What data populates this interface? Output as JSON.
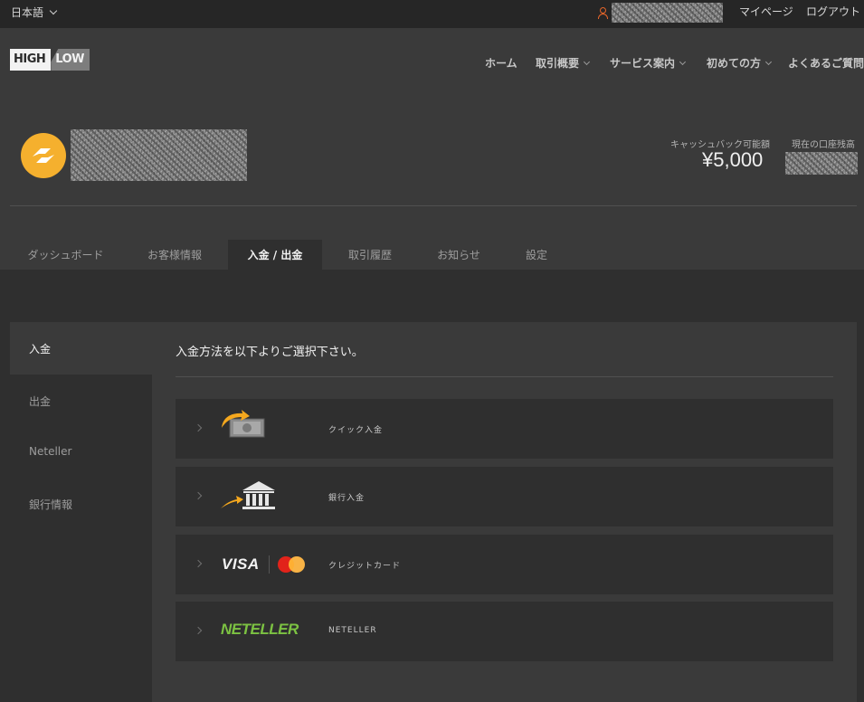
{
  "topbar": {
    "language": "日本語",
    "mypage": "マイページ",
    "logout": "ログアウト"
  },
  "header": {
    "logo_high": "HIGH",
    "logo_low": "LOW",
    "nav": [
      {
        "label": "ホーム",
        "dropdown": false
      },
      {
        "label": "取引概要",
        "dropdown": true
      },
      {
        "label": "サービス案内",
        "dropdown": true
      },
      {
        "label": "初めての方",
        "dropdown": true
      },
      {
        "label": "よくあるご質問",
        "dropdown": false
      }
    ]
  },
  "account": {
    "cashback_label": "キャッシュバック可能額",
    "cashback_value": "¥5,000",
    "balance_label": "現在の口座残高"
  },
  "tabs": [
    {
      "label": "ダッシュボード",
      "active": false
    },
    {
      "label": "お客様情報",
      "active": false
    },
    {
      "label": "入金 / 出金",
      "active": true
    },
    {
      "label": "取引履歴",
      "active": false
    },
    {
      "label": "お知らせ",
      "active": false
    },
    {
      "label": "設定",
      "active": false
    }
  ],
  "sidebar": [
    {
      "label": "入金",
      "active": true
    },
    {
      "label": "出金",
      "active": false
    },
    {
      "label": "Neteller",
      "active": false
    },
    {
      "label": "銀行情報",
      "active": false
    }
  ],
  "content": {
    "title": "入金方法を以下よりご選択下さい。",
    "methods": [
      {
        "label": "クイック入金",
        "icon": "quick-deposit-icon"
      },
      {
        "label": "銀行入金",
        "icon": "bank-icon"
      },
      {
        "label": "クレジットカード",
        "icon": "visa-mastercard-logo",
        "visa": "VISA"
      },
      {
        "label": "NETELLER",
        "icon": "neteller-logo",
        "logo_text": "NETELLER"
      }
    ]
  },
  "colors": {
    "accent_orange": "#e8662a",
    "avatar_yellow": "#f5b02e",
    "neteller_green": "#7cc242",
    "panel": "#3a3a3a",
    "background": "#2f2f2f"
  }
}
